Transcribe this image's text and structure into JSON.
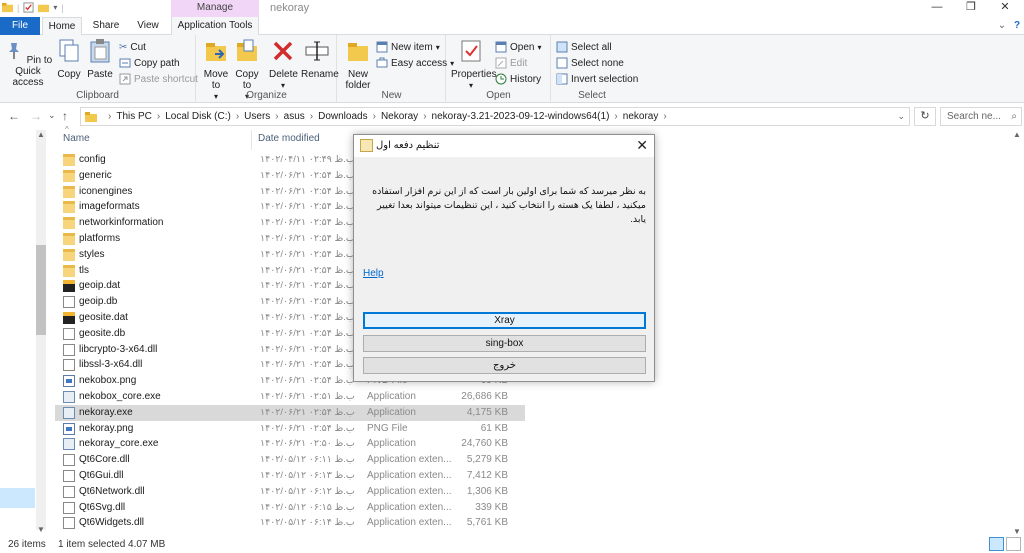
{
  "window": {
    "title": "nekoray",
    "contextual_tab": "Manage",
    "minimize": "—",
    "maximize": "❐",
    "close": "✕"
  },
  "tabs": {
    "file": "File",
    "home": "Home",
    "share": "Share",
    "view": "View",
    "app_tools": "Application Tools"
  },
  "ribbon": {
    "clipboard": {
      "label": "Clipboard",
      "pin": "Pin to Quick access",
      "copy": "Copy",
      "paste": "Paste",
      "cut": "Cut",
      "copy_path": "Copy path",
      "paste_shortcut": "Paste shortcut"
    },
    "organize": {
      "label": "Organize",
      "move_to": "Move to",
      "copy_to": "Copy to",
      "delete": "Delete",
      "rename": "Rename"
    },
    "new": {
      "label": "New",
      "new_folder": "New folder",
      "new_item": "New item",
      "easy_access": "Easy access"
    },
    "open": {
      "label": "Open",
      "properties": "Properties",
      "open": "Open",
      "edit": "Edit",
      "history": "History"
    },
    "select": {
      "label": "Select",
      "select_all": "Select all",
      "select_none": "Select none",
      "invert": "Invert selection"
    }
  },
  "address": {
    "crumbs": [
      "This PC",
      "Local Disk (C:)",
      "Users",
      "asus",
      "Downloads",
      "Nekoray",
      "nekoray-3.21-2023-09-12-windows64(1)",
      "nekoray"
    ],
    "search_placeholder": "Search ne..."
  },
  "columns": {
    "name": "Name",
    "date": "Date modified"
  },
  "files": [
    {
      "name": "config",
      "date": "۱۴۰۲/۰۴/۱۱ ب.ظ ۰۲:۴۹",
      "type": "",
      "size": "",
      "icon": "folder"
    },
    {
      "name": "generic",
      "date": "۱۴۰۲/۰۶/۲۱ ب.ظ ۰۲:۵۴",
      "type": "",
      "size": "",
      "icon": "folder"
    },
    {
      "name": "iconengines",
      "date": "۱۴۰۲/۰۶/۲۱ ب.ظ ۰۲:۵۴",
      "type": "",
      "size": "",
      "icon": "folder"
    },
    {
      "name": "imageformats",
      "date": "۱۴۰۲/۰۶/۲۱ ب.ظ ۰۲:۵۴",
      "type": "",
      "size": "",
      "icon": "folder"
    },
    {
      "name": "networkinformation",
      "date": "۱۴۰۲/۰۶/۲۱ ب.ظ ۰۲:۵۴",
      "type": "",
      "size": "",
      "icon": "folder"
    },
    {
      "name": "platforms",
      "date": "۱۴۰۲/۰۶/۲۱ ب.ظ ۰۲:۵۴",
      "type": "",
      "size": "",
      "icon": "folder"
    },
    {
      "name": "styles",
      "date": "۱۴۰۲/۰۶/۲۱ ب.ظ ۰۲:۵۴",
      "type": "",
      "size": "",
      "icon": "folder"
    },
    {
      "name": "tls",
      "date": "۱۴۰۲/۰۶/۲۱ ب.ظ ۰۲:۵۴",
      "type": "",
      "size": "",
      "icon": "folder"
    },
    {
      "name": "geoip.dat",
      "date": "۱۴۰۲/۰۶/۲۱ ب.ظ ۰۲:۵۴",
      "type": "",
      "size": "",
      "icon": "dat"
    },
    {
      "name": "geoip.db",
      "date": "۱۴۰۲/۰۶/۲۱ ب.ظ ۰۲:۵۴",
      "type": "",
      "size": "",
      "icon": "doc"
    },
    {
      "name": "geosite.dat",
      "date": "۱۴۰۲/۰۶/۲۱ ب.ظ ۰۲:۵۴",
      "type": "",
      "size": "",
      "icon": "dat"
    },
    {
      "name": "geosite.db",
      "date": "۱۴۰۲/۰۶/۲۱ ب.ظ ۰۲:۵۴",
      "type": "",
      "size": "",
      "icon": "doc"
    },
    {
      "name": "libcrypto-3-x64.dll",
      "date": "۱۴۰۲/۰۶/۲۱ ب.ظ ۰۲:۵۴",
      "type": "",
      "size": "",
      "icon": "doc"
    },
    {
      "name": "libssl-3-x64.dll",
      "date": "۱۴۰۲/۰۶/۲۱ ب.ظ ۰۲:۵۴",
      "type": "",
      "size": "",
      "icon": "doc"
    },
    {
      "name": "nekobox.png",
      "date": "۱۴۰۲/۰۶/۲۱ ب.ظ ۰۲:۵۴",
      "type": "PNG File",
      "size": "69 KB",
      "icon": "img"
    },
    {
      "name": "nekobox_core.exe",
      "date": "۱۴۰۲/۰۶/۲۱ ب.ظ ۰۲:۵۱",
      "type": "Application",
      "size": "26,686 KB",
      "icon": "app"
    },
    {
      "name": "nekoray.exe",
      "date": "۱۴۰۲/۰۶/۲۱ ب.ظ ۰۲:۵۴",
      "type": "Application",
      "size": "4,175 KB",
      "icon": "app",
      "selected": true
    },
    {
      "name": "nekoray.png",
      "date": "۱۴۰۲/۰۶/۲۱ ب.ظ ۰۲:۵۴",
      "type": "PNG File",
      "size": "61 KB",
      "icon": "img"
    },
    {
      "name": "nekoray_core.exe",
      "date": "۱۴۰۲/۰۶/۲۱ ب.ظ ۰۲:۵۰",
      "type": "Application",
      "size": "24,760 KB",
      "icon": "app"
    },
    {
      "name": "Qt6Core.dll",
      "date": "۱۴۰۲/۰۵/۱۲ ب.ظ ۰۶:۱۱",
      "type": "Application exten...",
      "size": "5,279 KB",
      "icon": "doc"
    },
    {
      "name": "Qt6Gui.dll",
      "date": "۱۴۰۲/۰۵/۱۲ ب.ظ ۰۶:۱۳",
      "type": "Application exten...",
      "size": "7,412 KB",
      "icon": "doc"
    },
    {
      "name": "Qt6Network.dll",
      "date": "۱۴۰۲/۰۵/۱۲ ب.ظ ۰۶:۱۲",
      "type": "Application exten...",
      "size": "1,306 KB",
      "icon": "doc"
    },
    {
      "name": "Qt6Svg.dll",
      "date": "۱۴۰۲/۰۵/۱۲ ب.ظ ۰۶:۱۵",
      "type": "Application exten...",
      "size": "339 KB",
      "icon": "doc"
    },
    {
      "name": "Qt6Widgets.dll",
      "date": "۱۴۰۲/۰۵/۱۲ ب.ظ ۰۶:۱۴",
      "type": "Application exten...",
      "size": "5,761 KB",
      "icon": "doc"
    }
  ],
  "status": {
    "items": "26 items",
    "selected": "1 item selected  4.07 MB"
  },
  "dialog": {
    "title": "تنظیم دفعه اول",
    "message": "به نظر میرسد که شما برای اولین بار است که از این نرم افزار استفاده میکنید ، لطفا یک هسته را انتخاب کنید ، این تنظیمات میتواند بعدا تغییر یابد.",
    "help": "Help",
    "btn_xray": "Xray",
    "btn_singbox": "sing-box",
    "btn_exit": "خروج"
  },
  "colors": {
    "accent": "#1a6ac7",
    "manage": "#f1d6f7",
    "selection": "#d9d9d9"
  }
}
